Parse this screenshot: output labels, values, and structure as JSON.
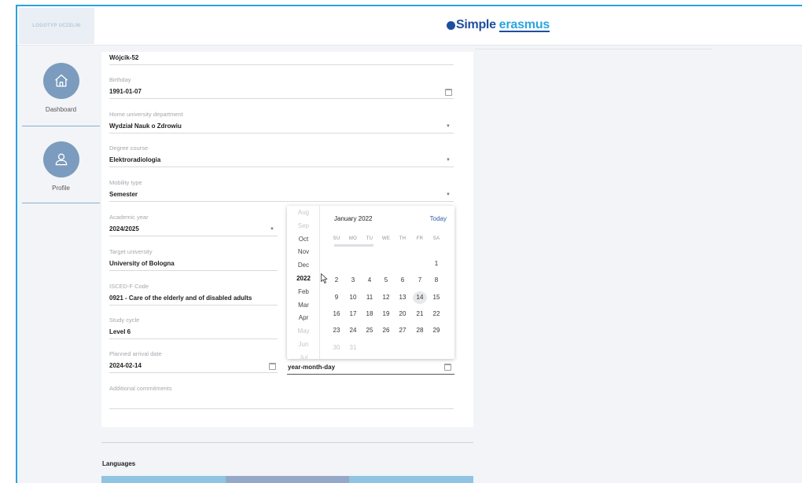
{
  "header": {
    "logo_placeholder": "LOGOTYP UCZELNI",
    "brand_simple": "Simple",
    "brand_erasmus": "erasmus"
  },
  "sidebar": {
    "items": [
      {
        "label": "Dashboard",
        "icon": "home-icon"
      },
      {
        "label": "Profile",
        "icon": "user-icon"
      }
    ]
  },
  "form": {
    "surname_value": "Wójcik-52",
    "birthday": {
      "label": "Birthday",
      "value": "1991-01-07"
    },
    "department": {
      "label": "Home university department",
      "value": "Wydział Nauk o Zdrowiu"
    },
    "degree": {
      "label": "Degree course",
      "value": "Elektroradiologia"
    },
    "mobility": {
      "label": "Mobility type",
      "value": "Semester"
    },
    "academic_year": {
      "label": "Academic year",
      "value": "2024/2025"
    },
    "target_university": {
      "label": "Target university",
      "value": "University of Bologna"
    },
    "isced": {
      "label": "ISCED-F Code",
      "value": "0921 - Care of the elderly and of disabled adults"
    },
    "study_cycle": {
      "label": "Study cycle",
      "value": "Level 6"
    },
    "arrival": {
      "label": "Planned arrival date",
      "value": "2024-02-14"
    },
    "departure": {
      "value": "year-month-day"
    },
    "commitments": {
      "label": "Additional commitments",
      "value": ""
    }
  },
  "languages": {
    "title": "Languages",
    "bar_colors": [
      "#8fc4e3",
      "#93a9c7",
      "#8fc4e3"
    ]
  },
  "datepicker": {
    "header": "January 2022",
    "today_label": "Today",
    "months": [
      {
        "label": "Aug",
        "state": "faded"
      },
      {
        "label": "Sep",
        "state": "faded"
      },
      {
        "label": "Oct",
        "state": "normal"
      },
      {
        "label": "Nov",
        "state": "normal"
      },
      {
        "label": "Dec",
        "state": "normal"
      },
      {
        "label": "2022",
        "state": "selected"
      },
      {
        "label": "Feb",
        "state": "normal"
      },
      {
        "label": "Mar",
        "state": "normal"
      },
      {
        "label": "Apr",
        "state": "normal"
      },
      {
        "label": "May",
        "state": "faded"
      },
      {
        "label": "Jun",
        "state": "faded"
      },
      {
        "label": "Jul",
        "state": "faded"
      }
    ],
    "weekdays": [
      "SU",
      "MO",
      "TU",
      "WE",
      "TH",
      "FR",
      "SA"
    ],
    "weeks": [
      [
        "",
        "",
        "",
        "",
        "",
        "",
        "1"
      ],
      [
        "2",
        "3",
        "4",
        "5",
        "6",
        "7",
        "8"
      ],
      [
        "9",
        "10",
        "11",
        "12",
        "13",
        "14",
        "15"
      ],
      [
        "16",
        "17",
        "18",
        "19",
        "20",
        "21",
        "22"
      ],
      [
        "23",
        "24",
        "25",
        "26",
        "27",
        "28",
        "29"
      ],
      [
        "30",
        "31",
        "",
        "",
        "",
        "",
        ""
      ]
    ],
    "highlighted_day": "14"
  },
  "colors": {
    "accent": "#29a3e0",
    "brand_dark": "#1e4f9e",
    "nav_circle": "#7b9cbe",
    "today_link": "#2b5ea8"
  }
}
